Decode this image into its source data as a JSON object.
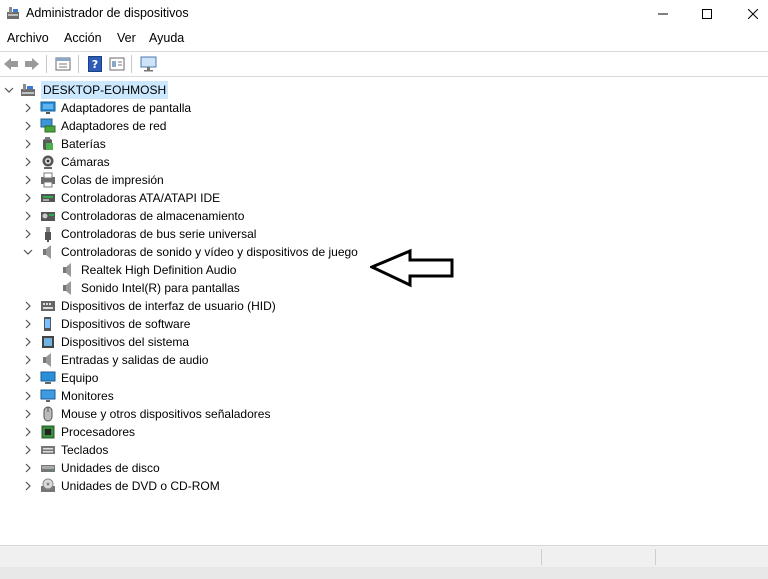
{
  "window": {
    "title": "Administrador de dispositivos"
  },
  "menu": [
    "Archivo",
    "Acción",
    "Ver",
    "Ayuda"
  ],
  "tree": {
    "root": "DESKTOP-EOHMOSH",
    "categories": [
      {
        "label": "Adaptadores de pantalla",
        "icon": "display-adapter-icon",
        "expanded": false
      },
      {
        "label": "Adaptadores de red",
        "icon": "network-adapter-icon",
        "expanded": false
      },
      {
        "label": "Baterías",
        "icon": "battery-icon",
        "expanded": false
      },
      {
        "label": "Cámaras",
        "icon": "camera-icon",
        "expanded": false
      },
      {
        "label": "Colas de impresión",
        "icon": "printer-icon",
        "expanded": false
      },
      {
        "label": "Controladoras ATA/ATAPI IDE",
        "icon": "ide-controller-icon",
        "expanded": false
      },
      {
        "label": "Controladoras de almacenamiento",
        "icon": "storage-controller-icon",
        "expanded": false
      },
      {
        "label": "Controladoras de bus serie universal",
        "icon": "usb-icon",
        "expanded": false
      },
      {
        "label": "Controladoras de sonido y vídeo y dispositivos de juego",
        "icon": "speaker-icon",
        "expanded": true,
        "children": [
          {
            "label": "Realtek High Definition Audio",
            "icon": "speaker-icon"
          },
          {
            "label": "Sonido Intel(R) para pantallas",
            "icon": "speaker-icon"
          }
        ]
      },
      {
        "label": "Dispositivos de interfaz de usuario (HID)",
        "icon": "hid-icon",
        "expanded": false
      },
      {
        "label": "Dispositivos de software",
        "icon": "software-device-icon",
        "expanded": false
      },
      {
        "label": "Dispositivos del sistema",
        "icon": "system-device-icon",
        "expanded": false
      },
      {
        "label": "Entradas y salidas de audio",
        "icon": "audio-io-icon",
        "expanded": false
      },
      {
        "label": "Equipo",
        "icon": "computer-icon",
        "expanded": false
      },
      {
        "label": "Monitores",
        "icon": "monitor-icon",
        "expanded": false
      },
      {
        "label": "Mouse y otros dispositivos señaladores",
        "icon": "mouse-icon",
        "expanded": false
      },
      {
        "label": "Procesadores",
        "icon": "processor-icon",
        "expanded": false
      },
      {
        "label": "Teclados",
        "icon": "keyboard-icon",
        "expanded": false
      },
      {
        "label": "Unidades de disco",
        "icon": "disk-drive-icon",
        "expanded": false
      },
      {
        "label": "Unidades de DVD o CD-ROM",
        "icon": "dvd-drive-icon",
        "expanded": false
      }
    ]
  },
  "colors": {
    "selection": "#cce8ff",
    "accent": "#0078d7"
  }
}
